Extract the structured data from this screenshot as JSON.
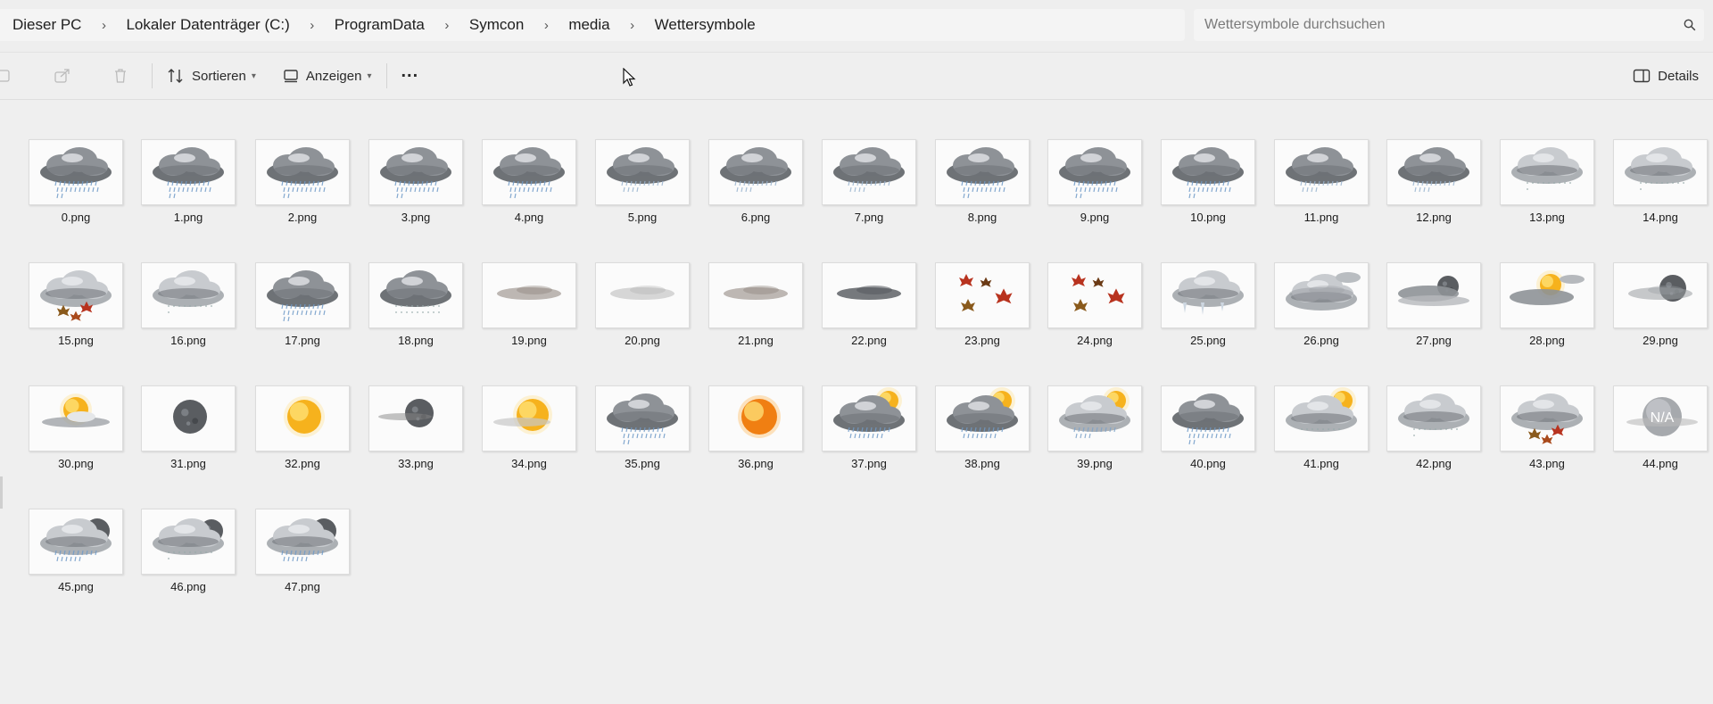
{
  "breadcrumb": [
    "Dieser PC",
    "Lokaler Datenträger (C:)",
    "ProgramData",
    "Symcon",
    "media",
    "Wettersymbole"
  ],
  "search": {
    "placeholder": "Wettersymbole durchsuchen",
    "icon": "search-icon"
  },
  "toolbar": {
    "sort_label": "Sortieren",
    "view_label": "Anzeigen",
    "more_label": "...",
    "details_label": "Details"
  },
  "files": [
    {
      "name": "0.png",
      "icon": "cloud-rain"
    },
    {
      "name": "1.png",
      "icon": "cloud-rain"
    },
    {
      "name": "2.png",
      "icon": "cloud-rain"
    },
    {
      "name": "3.png",
      "icon": "cloud-rain"
    },
    {
      "name": "4.png",
      "icon": "cloud-rain"
    },
    {
      "name": "5.png",
      "icon": "cloud-drizzle"
    },
    {
      "name": "6.png",
      "icon": "cloud-drizzle"
    },
    {
      "name": "7.png",
      "icon": "cloud-drizzle"
    },
    {
      "name": "8.png",
      "icon": "cloud-rain"
    },
    {
      "name": "9.png",
      "icon": "cloud-rain"
    },
    {
      "name": "10.png",
      "icon": "cloud-rain"
    },
    {
      "name": "11.png",
      "icon": "cloud-drizzle"
    },
    {
      "name": "12.png",
      "icon": "cloud-drizzle"
    },
    {
      "name": "13.png",
      "icon": "cloud-light"
    },
    {
      "name": "14.png",
      "icon": "cloud-light"
    },
    {
      "name": "15.png",
      "icon": "cloud-leaves"
    },
    {
      "name": "16.png",
      "icon": "cloud-light"
    },
    {
      "name": "17.png",
      "icon": "cloud-rain"
    },
    {
      "name": "18.png",
      "icon": "cloud-snow"
    },
    {
      "name": "19.png",
      "icon": "fog"
    },
    {
      "name": "20.png",
      "icon": "fog-light"
    },
    {
      "name": "21.png",
      "icon": "fog"
    },
    {
      "name": "22.png",
      "icon": "fog-dark"
    },
    {
      "name": "23.png",
      "icon": "leaves"
    },
    {
      "name": "24.png",
      "icon": "leaves"
    },
    {
      "name": "25.png",
      "icon": "cloud-icicles"
    },
    {
      "name": "26.png",
      "icon": "clouds-fog"
    },
    {
      "name": "27.png",
      "icon": "moon-clouds"
    },
    {
      "name": "28.png",
      "icon": "sun-clouds"
    },
    {
      "name": "29.png",
      "icon": "moon-fog"
    },
    {
      "name": "30.png",
      "icon": "sun-fog"
    },
    {
      "name": "31.png",
      "icon": "moon"
    },
    {
      "name": "32.png",
      "icon": "sun"
    },
    {
      "name": "33.png",
      "icon": "moon-haze"
    },
    {
      "name": "34.png",
      "icon": "sun-haze"
    },
    {
      "name": "35.png",
      "icon": "cloud-rain"
    },
    {
      "name": "36.png",
      "icon": "sun-hot"
    },
    {
      "name": "37.png",
      "icon": "sun-cloud-rain"
    },
    {
      "name": "38.png",
      "icon": "sun-cloud-rain"
    },
    {
      "name": "39.png",
      "icon": "sun-cloud-drizzle"
    },
    {
      "name": "40.png",
      "icon": "cloud-rain"
    },
    {
      "name": "41.png",
      "icon": "sun-cloud"
    },
    {
      "name": "42.png",
      "icon": "cloud-light"
    },
    {
      "name": "43.png",
      "icon": "cloud-leaves"
    },
    {
      "name": "44.png",
      "icon": "na"
    },
    {
      "name": "45.png",
      "icon": "moon-cloud-rain"
    },
    {
      "name": "46.png",
      "icon": "moon-cloud-light"
    },
    {
      "name": "47.png",
      "icon": "moon-cloud-rain"
    }
  ],
  "na_text": "N/A",
  "colors": {
    "rain": "#6f9ac8",
    "sun": "#f6b21d",
    "leaf": "#b8331f",
    "cloud": "#9a9ea3"
  }
}
